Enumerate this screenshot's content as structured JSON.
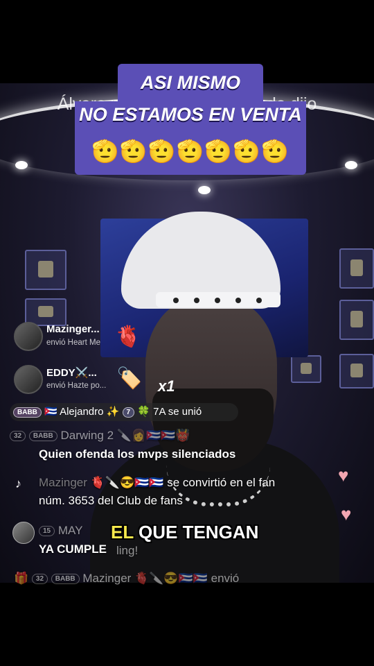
{
  "banner": {
    "line1": "ASI MISMO",
    "line2": "NO ESTAMOS EN VENTA",
    "emojis": "🫡🫡🫡🫡🫡🫡🫡"
  },
  "overlay_quote": "Álvaro no se equivocó cuando dijo",
  "gifts": [
    {
      "name": "Mazinger...",
      "sub": "envió Heart Me",
      "icon": "heart-me-gift-icon",
      "glyph": "🫀"
    },
    {
      "name": "EDDY⚔️...",
      "sub": "envió Hazte po...",
      "icon": "popular-gift-icon",
      "glyph": "🏷️",
      "multiplier": "x1"
    }
  ],
  "join_bar": {
    "badge": "BABB",
    "user": "Alejandro",
    "level": "7",
    "tail": "7A se unió"
  },
  "chat": {
    "row1_level": "32",
    "row1_badge": "BABB",
    "row1_user": "Darwing 2",
    "row2_text": "Quien ofenda los mvps silenciados",
    "row3_user": "Mazinger",
    "row3_text": "se convirtió en el fan",
    "row3_text2": "núm. 3653 del Club de fans",
    "row4_level": "15",
    "row4_user": "MAY",
    "row4_text": "YA CUMPLE",
    "row4_trail": "ling!",
    "row5_level": "32",
    "row5_badge": "BABB",
    "row5_user": "Mazinger",
    "row5_text": "envió"
  },
  "caption": {
    "highlight": "EL",
    "rest": "QUE TENGAN"
  },
  "colors": {
    "banner_purple": "#5b4fb6",
    "caption_yellow": "#f7e94c",
    "heart_pink": "#f2a6b1"
  }
}
